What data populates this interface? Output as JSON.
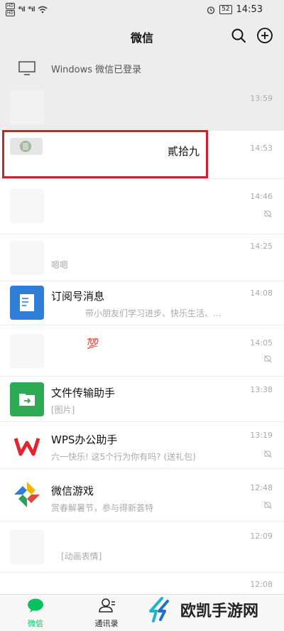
{
  "status_bar": {
    "sim1": "HD",
    "sim2": "HD",
    "signal1": "⁴⁶ıll",
    "signal2": "⁴⁶ıll",
    "battery": "52",
    "time": "14:53"
  },
  "header": {
    "title": "微信",
    "search_icon": "search-icon",
    "add_icon": "plus-circle-icon"
  },
  "login_banner": {
    "text": "Windows 微信已登录",
    "icon": "monitor-icon"
  },
  "chats": [
    {
      "name": "",
      "preview": "",
      "time": "13:59",
      "muted": false,
      "pinned": true
    },
    {
      "name": "貳拾九",
      "preview": "",
      "time": "14:53",
      "muted": false,
      "highlighted": true
    },
    {
      "name": "",
      "preview": "",
      "time": "14:46",
      "muted": true
    },
    {
      "name": "",
      "preview": "嗯嗯",
      "time": "14:25",
      "muted": false
    },
    {
      "name": "订阅号消息",
      "preview": "带小朋友们学习进步、快乐生活、...",
      "time": "14:08",
      "muted": false
    },
    {
      "name": "💯",
      "preview": "",
      "time": "14:05",
      "muted": true
    },
    {
      "name": "文件传输助手",
      "preview": "[图片]",
      "time": "13:38",
      "muted": false
    },
    {
      "name": "WPS办公助手",
      "preview": "六一快乐! 这5个行为你有吗? (送礼包)",
      "time": "13:19",
      "muted": true
    },
    {
      "name": "微信游戏",
      "preview": "赏春解暑节，参与得新荟特",
      "time": "12:48",
      "muted": true
    },
    {
      "name": "",
      "preview": "[动画表情]",
      "time": "12:09",
      "muted": false
    },
    {
      "name": "",
      "preview": "",
      "time": "12:08",
      "muted": false
    }
  ],
  "tabs": [
    {
      "label": "微信",
      "icon": "chat-bubble-icon",
      "active": true
    },
    {
      "label": "通讯录",
      "icon": "contacts-icon",
      "active": false
    }
  ],
  "watermark": {
    "text": "欧凯手游网"
  },
  "colors": {
    "accent": "#07c160",
    "highlight_border": "#d0202a",
    "header_bg": "#ededed"
  }
}
